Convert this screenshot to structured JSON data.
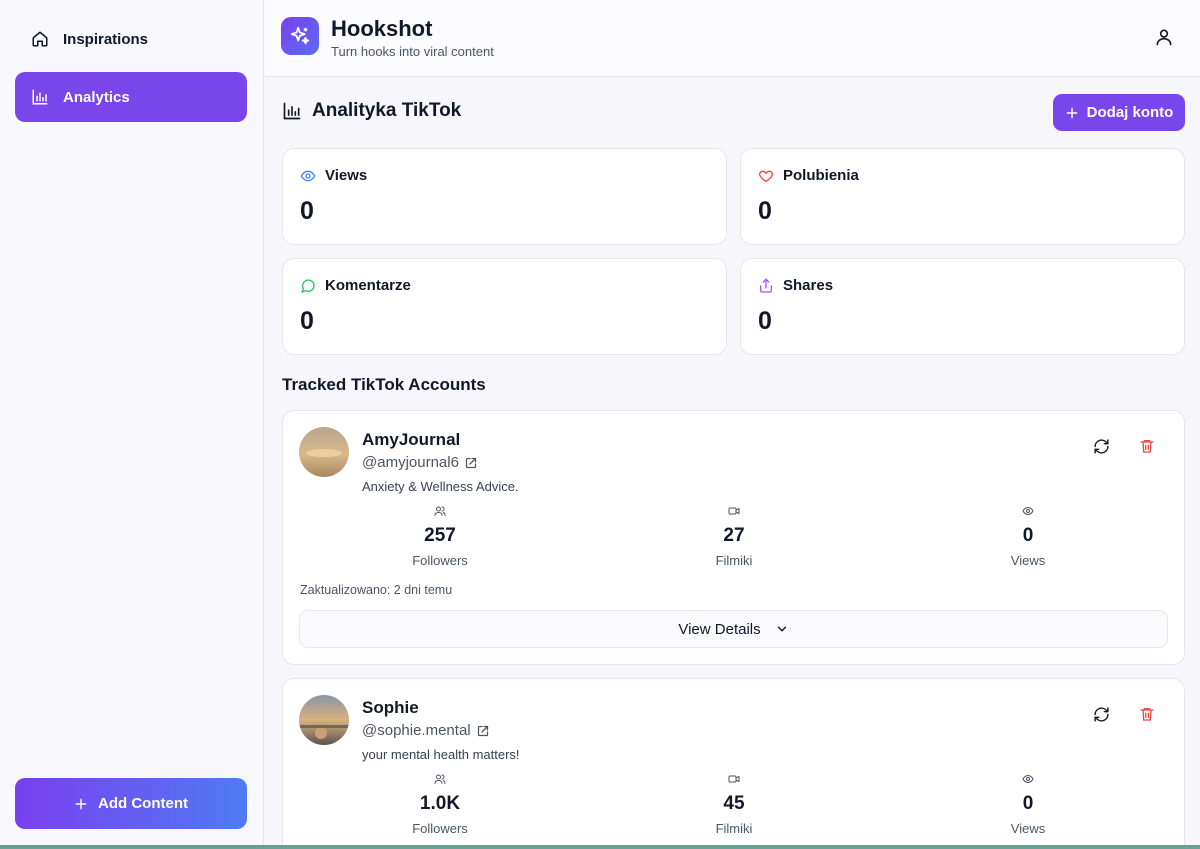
{
  "sidebar": {
    "items": [
      {
        "label": "Inspirations",
        "icon": "home-icon",
        "active": false
      },
      {
        "label": "Analytics",
        "icon": "bar-chart-icon",
        "active": true
      }
    ],
    "add_content_label": "Add Content"
  },
  "header": {
    "title": "Hookshot",
    "subtitle": "Turn hooks into viral content"
  },
  "analytics": {
    "title": "Analityka TikTok",
    "add_account_label": "Dodaj konto",
    "stats": [
      {
        "label": "Views",
        "value": "0",
        "icon": "eye-icon",
        "color": "#3b82f6"
      },
      {
        "label": "Polubienia",
        "value": "0",
        "icon": "heart-icon",
        "color": "#ef4444"
      },
      {
        "label": "Komentarze",
        "value": "0",
        "icon": "message-circle-icon",
        "color": "#22c55e"
      },
      {
        "label": "Shares",
        "value": "0",
        "icon": "share-icon",
        "color": "#a855f7"
      }
    ]
  },
  "tracked": {
    "title": "Tracked TikTok Accounts",
    "accounts": [
      {
        "name": "AmyJournal",
        "handle": "@amyjournal6",
        "bio": "Anxiety & Wellness Advice.",
        "followers": "257",
        "followers_label": "Followers",
        "videos": "27",
        "videos_label": "Filmiki",
        "views": "0",
        "views_label": "Views",
        "updated": "Zaktualizowano: 2 dni temu",
        "details_label": "View Details"
      },
      {
        "name": "Sophie",
        "handle": "@sophie.mental",
        "bio": "your mental health matters!",
        "followers": "1.0K",
        "followers_label": "Followers",
        "videos": "45",
        "videos_label": "Filmiki",
        "views": "0",
        "views_label": "Views"
      }
    ]
  },
  "colors": {
    "accent": "#7b45ec",
    "danger": "#ef4444"
  }
}
